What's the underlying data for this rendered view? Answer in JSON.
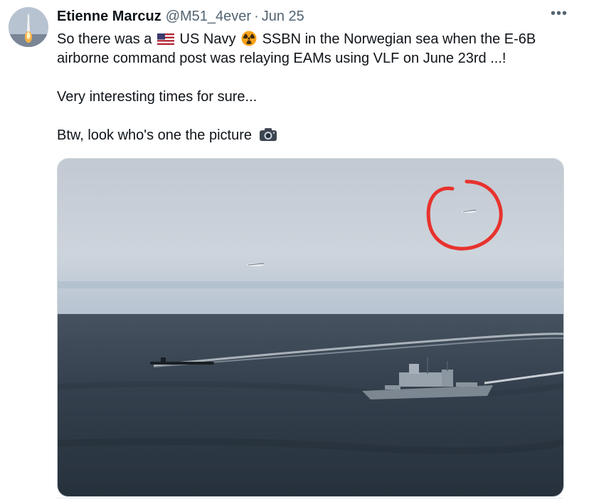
{
  "author": {
    "display_name": "Etienne Marcuz",
    "handle": "@M51_4ever",
    "separator": "·",
    "date": "Jun 25"
  },
  "more_label": "•••",
  "tweet": {
    "line1_a": "So there was a",
    "line1_b": "US Navy",
    "line1_c": "SSBN in the Norwegian sea when the E-6B airborne command post was relaying EAMs using VLF on June 23rd ...!",
    "line2": "Very interesting times for sure...",
    "line3": "Btw, look who's one the picture"
  },
  "icons": {
    "flag": "us-flag-icon",
    "radioactive": "radioactive-icon",
    "camera": "camera-icon",
    "more": "more-icon"
  },
  "colors": {
    "text": "#0f1419",
    "secondary": "#536471",
    "circle": "#e8322d",
    "sea": "#2f3c4a",
    "sky": "#c4ccd8"
  }
}
